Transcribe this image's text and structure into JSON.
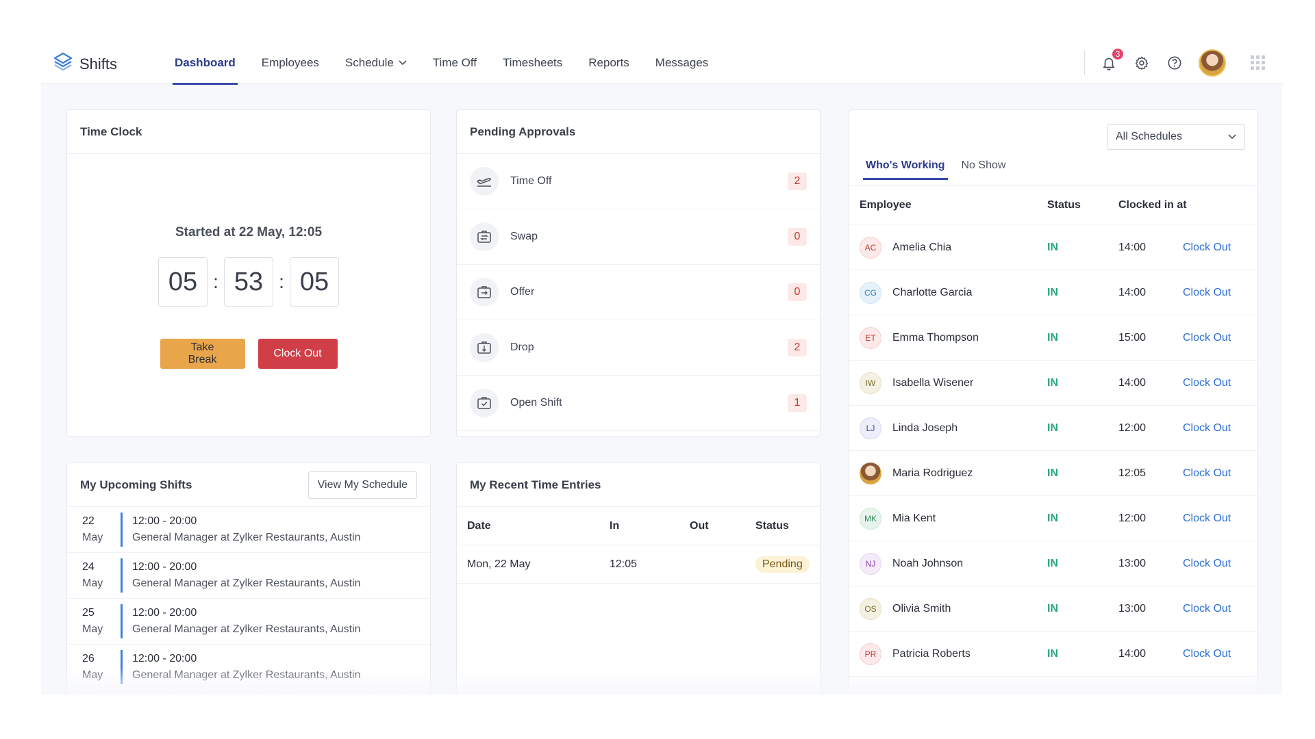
{
  "app": {
    "name": "Shifts"
  },
  "nav": {
    "items": [
      {
        "label": "Dashboard"
      },
      {
        "label": "Employees"
      },
      {
        "label": "Schedule"
      },
      {
        "label": "Time Off"
      },
      {
        "label": "Timesheets"
      },
      {
        "label": "Reports"
      },
      {
        "label": "Messages"
      }
    ],
    "active": "Dashboard"
  },
  "topbar": {
    "notification_count": "3"
  },
  "time_clock": {
    "title": "Time Clock",
    "started": "Started at 22 May, 12:05",
    "hours": "05",
    "minutes": "53",
    "seconds": "05",
    "take_break_label": "Take Break",
    "clock_out_label": "Clock Out"
  },
  "pending_approvals": {
    "title": "Pending Approvals",
    "items": [
      {
        "label": "Time Off",
        "count": "2",
        "icon": "plane-departure-icon"
      },
      {
        "label": "Swap",
        "count": "0",
        "icon": "swap-briefcase-icon"
      },
      {
        "label": "Offer",
        "count": "0",
        "icon": "offer-briefcase-icon"
      },
      {
        "label": "Drop",
        "count": "2",
        "icon": "drop-briefcase-icon"
      },
      {
        "label": "Open Shift",
        "count": "1",
        "icon": "open-shift-briefcase-icon"
      }
    ]
  },
  "upcoming_shifts": {
    "title": "My Upcoming Shifts",
    "view_button_label": "View My Schedule",
    "items": [
      {
        "day": "22",
        "month": "May",
        "time": "12:00 - 20:00",
        "location": "General Manager at Zylker Restaurants, Austin"
      },
      {
        "day": "24",
        "month": "May",
        "time": "12:00 - 20:00",
        "location": "General Manager at Zylker Restaurants, Austin"
      },
      {
        "day": "25",
        "month": "May",
        "time": "12:00 - 20:00",
        "location": "General Manager at Zylker Restaurants, Austin"
      },
      {
        "day": "26",
        "month": "May",
        "time": "12:00 - 20:00",
        "location": "General Manager at Zylker Restaurants, Austin"
      }
    ]
  },
  "recent_entries": {
    "title": "My Recent Time Entries",
    "columns": [
      "Date",
      "In",
      "Out",
      "Status"
    ],
    "rows": [
      {
        "date": "Mon, 22 May",
        "in": "12:05",
        "out": "",
        "status": "Pending"
      }
    ]
  },
  "whos_working": {
    "schedule_select": "All Schedules",
    "tabs": [
      {
        "label": "Who's Working"
      },
      {
        "label": "No Show"
      }
    ],
    "active_tab": "Who's Working",
    "columns": [
      "Employee",
      "Status",
      "Clocked in at"
    ],
    "rows": [
      {
        "initials": "AC",
        "name": "Amelia Chia",
        "status": "IN",
        "time": "14:00",
        "action": "Clock Out",
        "color": "#c0392b"
      },
      {
        "initials": "CG",
        "name": "Charlotte Garcia",
        "status": "IN",
        "time": "14:00",
        "action": "Clock Out",
        "color": "#2e86c1"
      },
      {
        "initials": "ET",
        "name": "Emma Thompson",
        "status": "IN",
        "time": "15:00",
        "action": "Clock Out",
        "color": "#c0392b"
      },
      {
        "initials": "IW",
        "name": "Isabella Wisener",
        "status": "IN",
        "time": "14:00",
        "action": "Clock Out",
        "color": "#7d6a2b"
      },
      {
        "initials": "LJ",
        "name": "Linda Joseph",
        "status": "IN",
        "time": "12:00",
        "action": "Clock Out",
        "color": "#3949ab"
      },
      {
        "initials": "",
        "name": "Maria Rodriguez",
        "status": "IN",
        "time": "12:05",
        "action": "Clock Out",
        "color": "#8b5a35"
      },
      {
        "initials": "MK",
        "name": "Mia Kent",
        "status": "IN",
        "time": "12:00",
        "action": "Clock Out",
        "color": "#2e8b57"
      },
      {
        "initials": "NJ",
        "name": "Noah Johnson",
        "status": "IN",
        "time": "13:00",
        "action": "Clock Out",
        "color": "#8e44ad"
      },
      {
        "initials": "OS",
        "name": "Olivia Smith",
        "status": "IN",
        "time": "13:00",
        "action": "Clock Out",
        "color": "#7d6a2b"
      },
      {
        "initials": "PR",
        "name": "Patricia Roberts",
        "status": "IN",
        "time": "14:00",
        "action": "Clock Out",
        "color": "#c0392b"
      }
    ]
  },
  "colors": {
    "accent": "#3949ab",
    "status_in": "#2aa77a",
    "link": "#2e6fd6",
    "take_break": "#e8a54a",
    "clock_out": "#d03e48"
  }
}
